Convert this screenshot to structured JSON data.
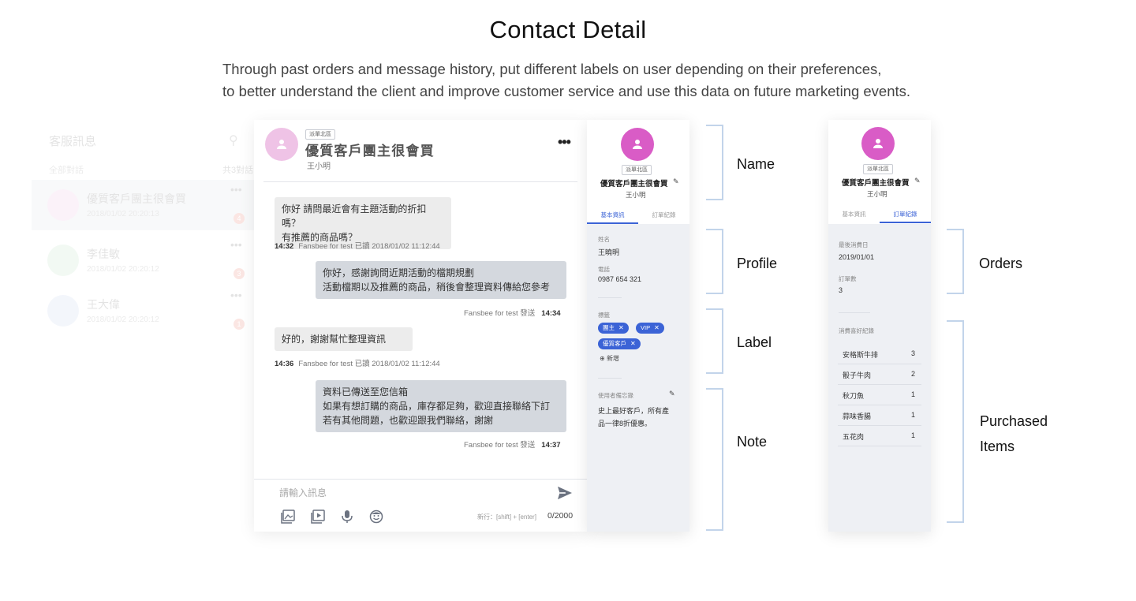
{
  "header": {
    "title": "Contact Detail",
    "description_line1": "Through past orders and message history, put different labels on user depending on their preferences,",
    "description_line2": "to better understand the client and improve customer service and use this data on future marketing events."
  },
  "conversation_list": {
    "title": "客服訊息",
    "subtitle": "全部對話",
    "count": "共3對話",
    "items": [
      {
        "tag": "派單北區",
        "name": "優質客戶團主很會買",
        "date": "2018/01/02 20:20:13",
        "badge": "4"
      },
      {
        "name": "李佳敏",
        "date": "2018/01/02 20:20:12",
        "badge": "3"
      },
      {
        "name": "王大偉",
        "date": "2018/01/02 20:20:12",
        "badge": "1"
      }
    ]
  },
  "chat": {
    "tag": "派單北區",
    "contact_name": "優質客戶團主很會買",
    "contact_sub": "王小明",
    "messages": [
      {
        "line1": "你好 請問最近會有主題活動的折扣嗎？",
        "line2": "有推薦的商品嗎？",
        "time": "14:32",
        "status": "Fansbee for test 已讀 2018/01/02 11:12:44"
      },
      {
        "line1": "你好，感謝詢問近期活動的檔期規劃",
        "line2": "活動檔期以及推薦的商品，稍後會整理資料傳給您參考",
        "sender": "Fansbee for test 發送",
        "time": "14:34"
      },
      {
        "line1": "好的，謝謝幫忙整理資訊",
        "time": "14:36",
        "status": "Fansbee for test 已讀 2018/01/02 11:12:44"
      },
      {
        "line1": "資料已傳送至您信箱",
        "line2": "如果有想訂購的商品，庫存都足夠，歡迎直接聯絡下訂",
        "line3": "若有其他問題，也歡迎跟我們聯絡，謝謝",
        "sender": "Fansbee for test 發送",
        "time": "14:37"
      }
    ],
    "composer": {
      "placeholder": "請輸入訊息",
      "hint": "新行：[shift] + [enter]",
      "count": "0/2000"
    }
  },
  "profile_panel": {
    "tag": "派單北區",
    "name": "優質客戶團主很會買",
    "sub": "王小明",
    "tabs": [
      "基本資訊",
      "訂單紀錄"
    ],
    "fields": {
      "name_label": "姓名",
      "name_value": "王曉明",
      "phone_label": "電話",
      "phone_value": "0987 654 321"
    },
    "labels_title": "標籤",
    "labels": [
      "團主",
      "VIP",
      "優質客戶"
    ],
    "add_label": "新增",
    "note_title": "使用者備忘錄",
    "note_line1": "史上最好客戶，所有產",
    "note_line2": "品一律8折優惠。"
  },
  "orders_panel": {
    "tag": "派單北區",
    "name": "優質客戶團主很會買",
    "sub": "王小明",
    "tabs": [
      "基本資訊",
      "訂單紀錄"
    ],
    "last_purchase_label": "最後消費日",
    "last_purchase_value": "2019/01/01",
    "order_count_label": "訂單數",
    "order_count_value": "3",
    "items_title": "消費喜好紀錄",
    "items": [
      {
        "name": "安格斯牛排",
        "count": "3"
      },
      {
        "name": "骰子牛肉",
        "count": "2"
      },
      {
        "name": "秋刀魚",
        "count": "1"
      },
      {
        "name": "蒜味香腸",
        "count": "1"
      },
      {
        "name": "五花肉",
        "count": "1"
      }
    ]
  },
  "annotations": {
    "name": "Name",
    "profile": "Profile",
    "label": "Label",
    "note": "Note",
    "orders": "Orders",
    "purchased_line1": "Purchased",
    "purchased_line2": "Items"
  },
  "colors": {
    "accent": "#3b63d6",
    "avatar": "#d95cc6",
    "avatar_light": "#efc3e6",
    "bracket": "#c2d4ea",
    "badge": "#e84a2f"
  }
}
